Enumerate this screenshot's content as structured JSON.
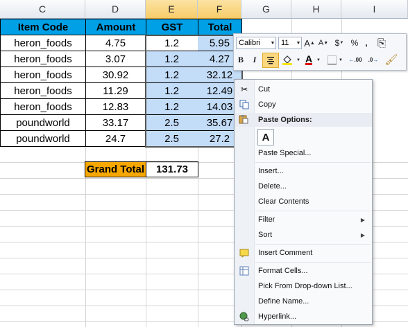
{
  "columns": [
    "C",
    "D",
    "E",
    "F",
    "G",
    "H",
    "I"
  ],
  "table": {
    "headers": [
      "Item Code",
      "Amount",
      "GST",
      "Total"
    ],
    "rows": [
      [
        "heron_foods",
        "4.75",
        "1.2",
        "5.95"
      ],
      [
        "heron_foods",
        "3.07",
        "1.2",
        "4.27"
      ],
      [
        "heron_foods",
        "30.92",
        "1.2",
        "32.12"
      ],
      [
        "heron_foods",
        "11.29",
        "1.2",
        "12.49"
      ],
      [
        "heron_foods",
        "12.83",
        "1.2",
        "14.03"
      ],
      [
        "poundworld",
        "33.17",
        "2.5",
        "35.67"
      ],
      [
        "poundworld",
        "24.7",
        "2.5",
        "27.2"
      ]
    ]
  },
  "grand_total": {
    "label": "Grand Total",
    "value": "131.73"
  },
  "mini_toolbar": {
    "font": "Calibri",
    "size": "11",
    "grow_font": "A",
    "shrink_font": "A",
    "currency": "$",
    "percent": "%",
    "comma": ",",
    "bold": "B",
    "italic": "I",
    "font_color": "A",
    "inc_decimal": ".00",
    "dec_decimal": ".0"
  },
  "context_menu": {
    "cut": "Cut",
    "copy": "Copy",
    "paste_options_header": "Paste Options:",
    "paste_icon_letter": "A",
    "paste_special": "Paste Special...",
    "insert": "Insert...",
    "delete": "Delete...",
    "clear_contents": "Clear Contents",
    "filter": "Filter",
    "sort": "Sort",
    "insert_comment": "Insert Comment",
    "format_cells": "Format Cells...",
    "pick_from_list": "Pick From Drop-down List...",
    "define_name": "Define Name...",
    "hyperlink": "Hyperlink..."
  },
  "colors": {
    "header_fill": "#00a0e6",
    "selection_fill": "#c3dcf7",
    "grand_total_fill": "#f7a800"
  }
}
